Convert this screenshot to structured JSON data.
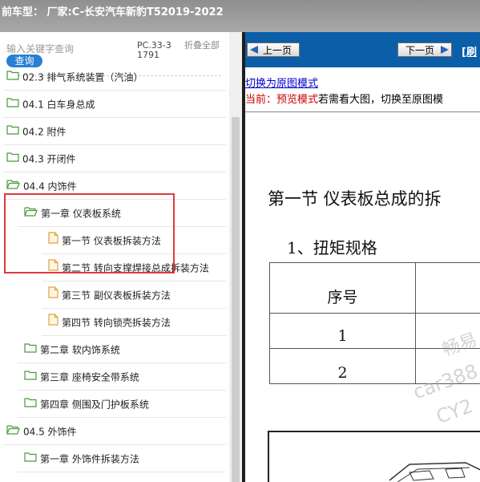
{
  "header": {
    "title": "前车型：  厂家:C-长安汽车新豹T52019-2022"
  },
  "search": {
    "placeholder": "输入关键字查询",
    "button": "查询",
    "code": "PC.33-31791",
    "collapse": "折叠全部"
  },
  "tree": [
    {
      "label": "02.3 排气系统装置（汽油）",
      "icon": "folder-icon",
      "level": 0
    },
    {
      "label": "04.1 白车身总成",
      "icon": "folder-icon",
      "level": 0
    },
    {
      "label": "04.2 附件",
      "icon": "folder-icon",
      "level": 0
    },
    {
      "label": "04.3 开闭件",
      "icon": "folder-icon",
      "level": 0
    },
    {
      "label": "04.4 内饰件",
      "icon": "folder-open-icon",
      "level": 0
    },
    {
      "label": "第一章 仪表板系统",
      "icon": "folder-open-icon",
      "level": 1
    },
    {
      "label": "第一节 仪表板拆装方法",
      "icon": "document-icon",
      "level": 2
    },
    {
      "label": "第二节 转向支撑焊接总成拆装方法",
      "icon": "document-icon",
      "level": 2
    },
    {
      "label": "第三节 副仪表板拆装方法",
      "icon": "document-icon",
      "level": 2
    },
    {
      "label": "第四节 转向锁壳拆装方法",
      "icon": "document-icon",
      "level": 2
    },
    {
      "label": "第二章 软内饰系统",
      "icon": "folder-icon",
      "level": 1
    },
    {
      "label": "第三章 座椅安全带系统",
      "icon": "folder-icon",
      "level": 1
    },
    {
      "label": "第四章 侧围及门护板系统",
      "icon": "folder-icon",
      "level": 1
    },
    {
      "label": "04.5 外饰件",
      "icon": "folder-open-icon",
      "level": 0
    },
    {
      "label": "第一章 外饰件拆装方法",
      "icon": "folder-icon",
      "level": 1
    }
  ],
  "toolbar": {
    "prev": "上一页",
    "next": "下一页",
    "refresh": "[刷"
  },
  "content": {
    "switch_link": "切换为原图模式",
    "status_label": "当前：预览模式",
    "status_text": "若需看大图，切换至原图模",
    "heading": "第一节  仪表板总成的拆",
    "subheading": "1、扭矩规格",
    "table_header": "序号",
    "table_rows": [
      "1",
      "2"
    ],
    "watermarks": [
      "畅易",
      "car388",
      "CY2"
    ]
  },
  "colors": {
    "header_bg": "#a3a3a3",
    "toolbar_bg": "#0b5ea8",
    "highlight": "#e0393e",
    "status_red": "#cc0000",
    "link": "#0000cc"
  }
}
